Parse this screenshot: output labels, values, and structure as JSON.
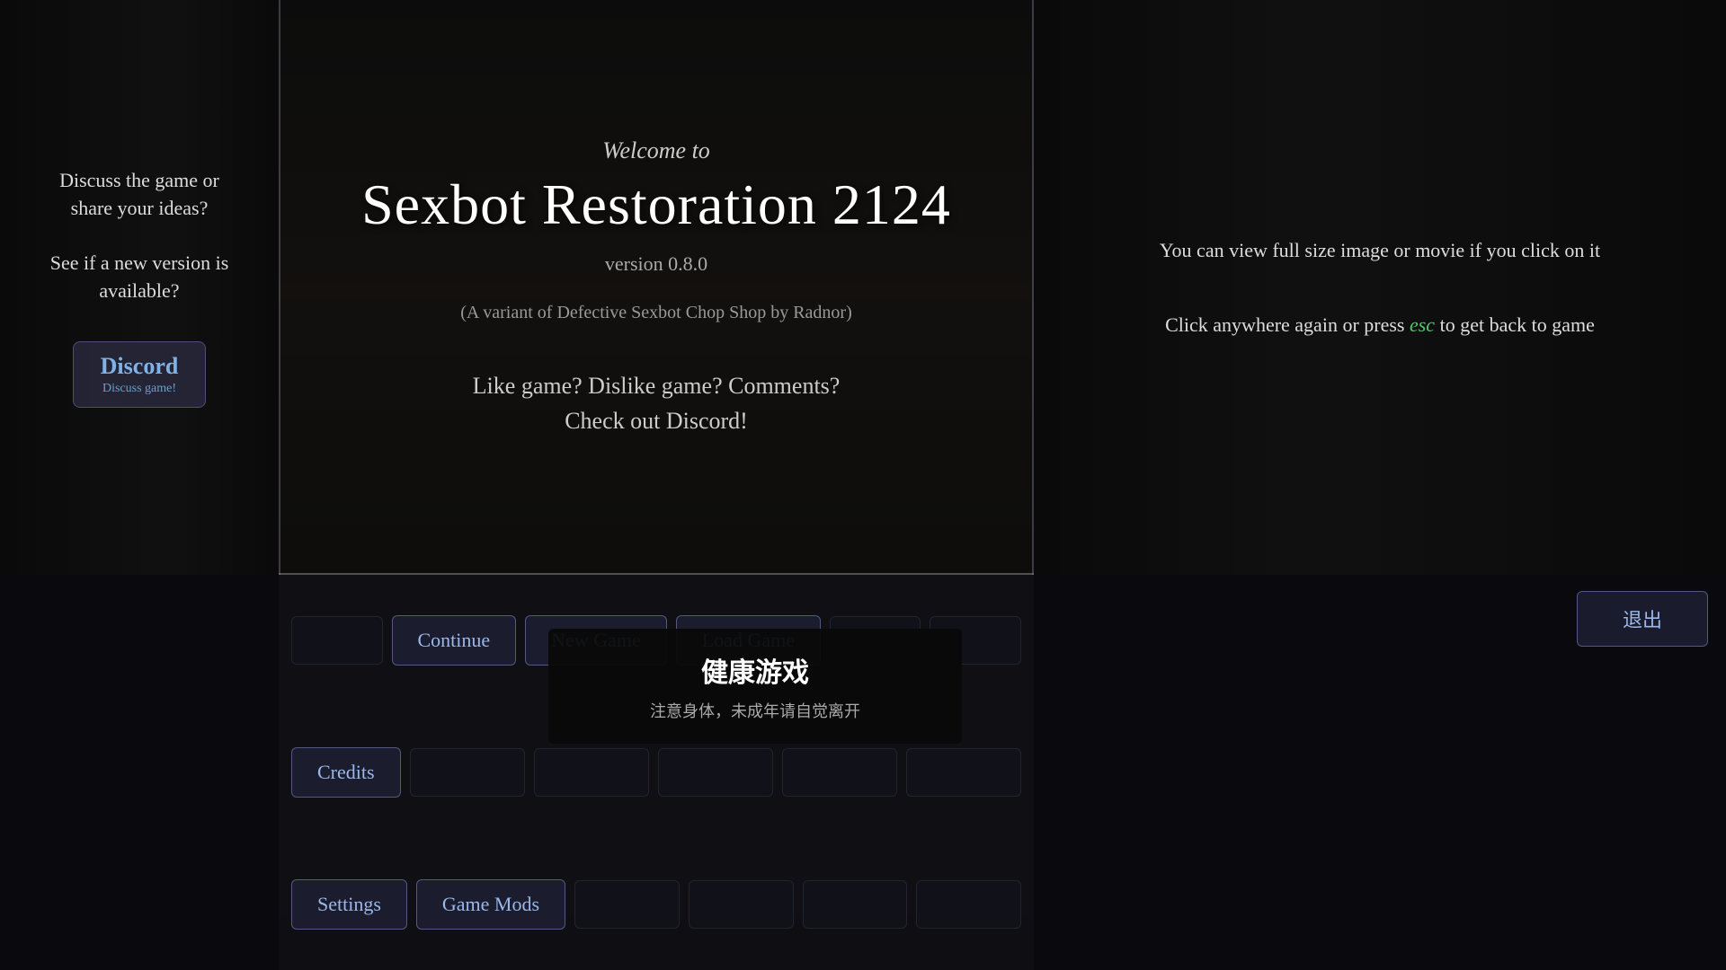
{
  "background": {
    "left_color": "#1a1a1a",
    "center_color": "#2a2520",
    "right_color": "#1a1a1a"
  },
  "left_sidebar": {
    "discuss_text": "Discuss the game or share your ideas?\n\nSee if a new version is available?",
    "discord_btn_label": "Discord",
    "discord_btn_sub": "Discuss game!"
  },
  "center": {
    "welcome_label": "Welcome to",
    "title": "Sexbot Restoration 2124",
    "version": "version 0.8.0",
    "variant": "(A variant of Defective Sexbot Chop Shop by Radnor)",
    "discord_prompt_line1": "Like game? Dislike game? Comments?",
    "discord_prompt_line2": "Check out Discord!"
  },
  "right_sidebar": {
    "tip1": "You can view full size image or movie if you click on it",
    "tip2_before_esc": "Click anywhere again or press ",
    "esc_label": "esc",
    "tip2_after_esc": " to get back to game"
  },
  "buttons": {
    "continue": "Continue",
    "new_game": "New Game",
    "load_game": "Load Game",
    "credits": "Credits",
    "settings": "Settings",
    "game_mods": "Game Mods",
    "quit": "退出"
  },
  "health_warning": {
    "title": "健康游戏",
    "subtitle": "注意身体，未成年请自觉离开"
  }
}
